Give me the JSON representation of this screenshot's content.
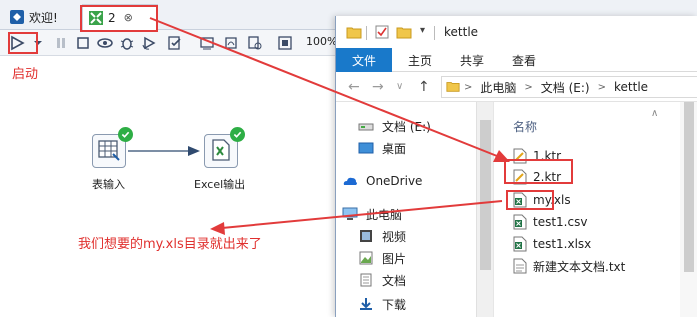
{
  "spoon": {
    "tabs": [
      {
        "label": "欢迎!",
        "icon": "spoon-icon"
      },
      {
        "label": "2",
        "icon": "transformation-icon",
        "close": "⊗"
      }
    ],
    "toolbar": {
      "zoom": "100%",
      "buttons": [
        "run-icon",
        "run-dropdown-icon",
        "pause-icon",
        "stop-icon",
        "preview-icon",
        "debug-icon",
        "replay-icon",
        "verify-icon",
        "impact-icon",
        "sql-icon",
        "explore-db-icon",
        "show-results-icon"
      ]
    },
    "steps": [
      {
        "label": "表输入",
        "icon": "table-input-icon",
        "status": "success"
      },
      {
        "label": "Excel输出",
        "icon": "excel-output-icon",
        "status": "success"
      }
    ],
    "annotations": {
      "start": "启动",
      "note": "我们想要的my.xls目录就出来了"
    }
  },
  "explorer": {
    "quick_access_title": "kettle",
    "ribbon_tabs": [
      "文件",
      "主页",
      "共享",
      "查看"
    ],
    "address": {
      "crumbs": [
        "此电脑",
        "文档 (E:)",
        "kettle"
      ],
      "separator": ">"
    },
    "nav_items": [
      {
        "label": "文档 (E:)",
        "icon": "drive-icon"
      },
      {
        "label": "桌面",
        "icon": "desktop-folder-icon"
      },
      {
        "label": "OneDrive",
        "icon": "onedrive-icon"
      },
      {
        "label": "此电脑",
        "icon": "computer-icon"
      },
      {
        "label": "视频",
        "icon": "videos-folder-icon"
      },
      {
        "label": "图片",
        "icon": "pictures-folder-icon"
      },
      {
        "label": "文档",
        "icon": "documents-folder-icon"
      },
      {
        "label": "下载",
        "icon": "downloads-folder-icon"
      }
    ],
    "column_header": "名称",
    "files": [
      {
        "name": "1.ktr",
        "icon": "ktr-file-icon"
      },
      {
        "name": "2.ktr",
        "icon": "ktr-file-icon"
      },
      {
        "name": "my.xls",
        "icon": "excel-file-icon"
      },
      {
        "name": "test1.csv",
        "icon": "excel-file-icon"
      },
      {
        "name": "test1.xlsx",
        "icon": "excel-file-icon"
      },
      {
        "name": "新建文本文档.txt",
        "icon": "text-file-icon"
      }
    ]
  },
  "colors": {
    "accent_red": "#e23b3b",
    "ribbon_blue": "#1979ca",
    "success_green": "#2eae45"
  }
}
